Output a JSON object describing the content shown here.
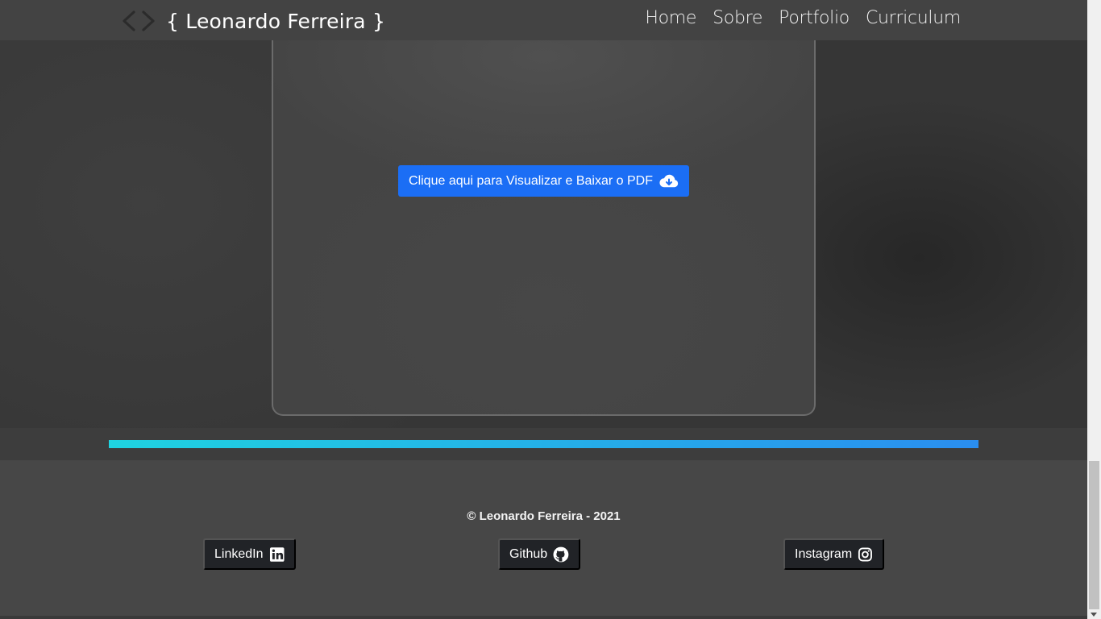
{
  "header": {
    "brand": "{ Leonardo Ferreira }",
    "code_icon": "code-brackets-icon",
    "nav": [
      {
        "label": "Home"
      },
      {
        "label": "Sobre"
      },
      {
        "label": "Portfolio"
      },
      {
        "label": "Curriculum"
      }
    ]
  },
  "main": {
    "pdf_button": {
      "label": "Clique aqui para Visualizar e Baixar o PDF",
      "icon": "cloud-download-icon"
    }
  },
  "footer": {
    "copyright": "© Leonardo Ferreira - 2021",
    "social": [
      {
        "label": "LinkedIn",
        "icon": "linkedin-icon"
      },
      {
        "label": "Github",
        "icon": "github-icon"
      },
      {
        "label": "Instagram",
        "icon": "instagram-icon"
      }
    ]
  },
  "colors": {
    "accent_blue": "#1b6ef5",
    "gradient_start": "#1fd3e0",
    "gradient_end": "#2a8ef0",
    "header_bg": "#434343",
    "footer_bg": "#474747",
    "social_btn_bg": "#212327"
  }
}
